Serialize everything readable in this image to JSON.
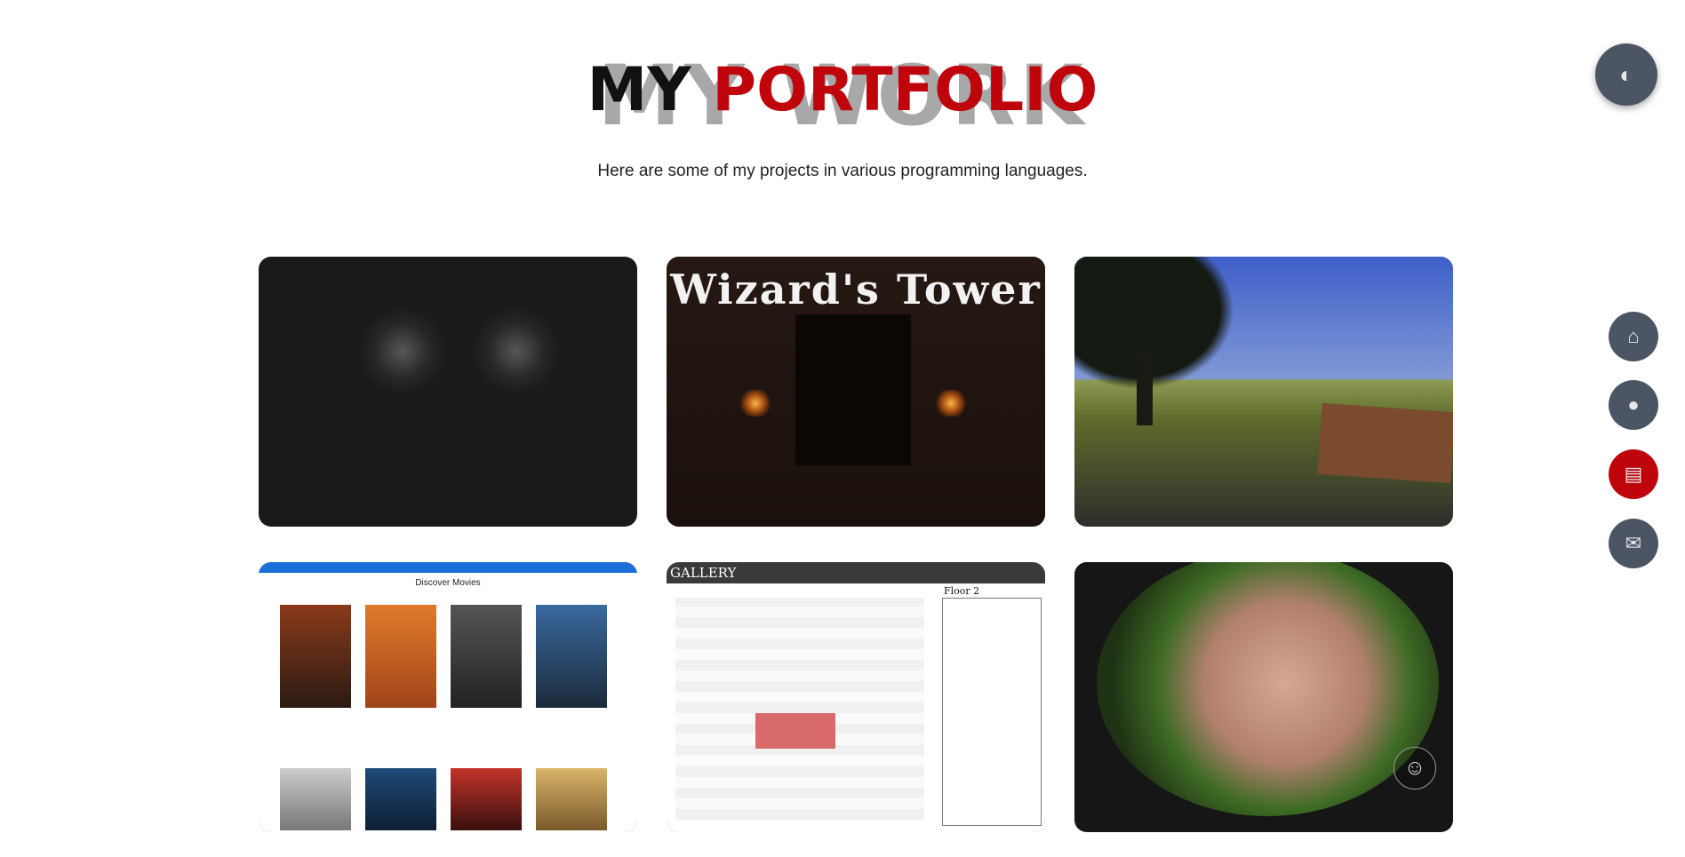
{
  "header": {
    "background_word": "MY WORK",
    "title_part1": "MY",
    "title_part2": "PORTFOLIO",
    "subtitle": "Here are some of my projects in various programming languages."
  },
  "colors": {
    "accent": "#c0040c",
    "nav_button": "#4b5563",
    "heading_dark": "#111111",
    "background_word": "#9a9a9a"
  },
  "projects": [
    {
      "name": "dark-horror-game"
    },
    {
      "name": "wizards-tower",
      "image_text": "Wizard's Tower"
    },
    {
      "name": "landscape-scene"
    },
    {
      "name": "movie-discovery-app",
      "image_text": "Discover Movies"
    },
    {
      "name": "gallery-route-finder",
      "image_text": "GALLERY",
      "floor_label": "Floor 2"
    },
    {
      "name": "profile-portrait"
    }
  ],
  "nav": {
    "items": [
      {
        "name": "home",
        "icon": "home-icon",
        "active": false
      },
      {
        "name": "about",
        "icon": "user-icon",
        "active": false
      },
      {
        "name": "portfolio",
        "icon": "briefcase-icon",
        "active": true
      },
      {
        "name": "contact",
        "icon": "envelope-icon",
        "active": false
      }
    ],
    "theme_toggle_icon": "contrast-icon"
  }
}
